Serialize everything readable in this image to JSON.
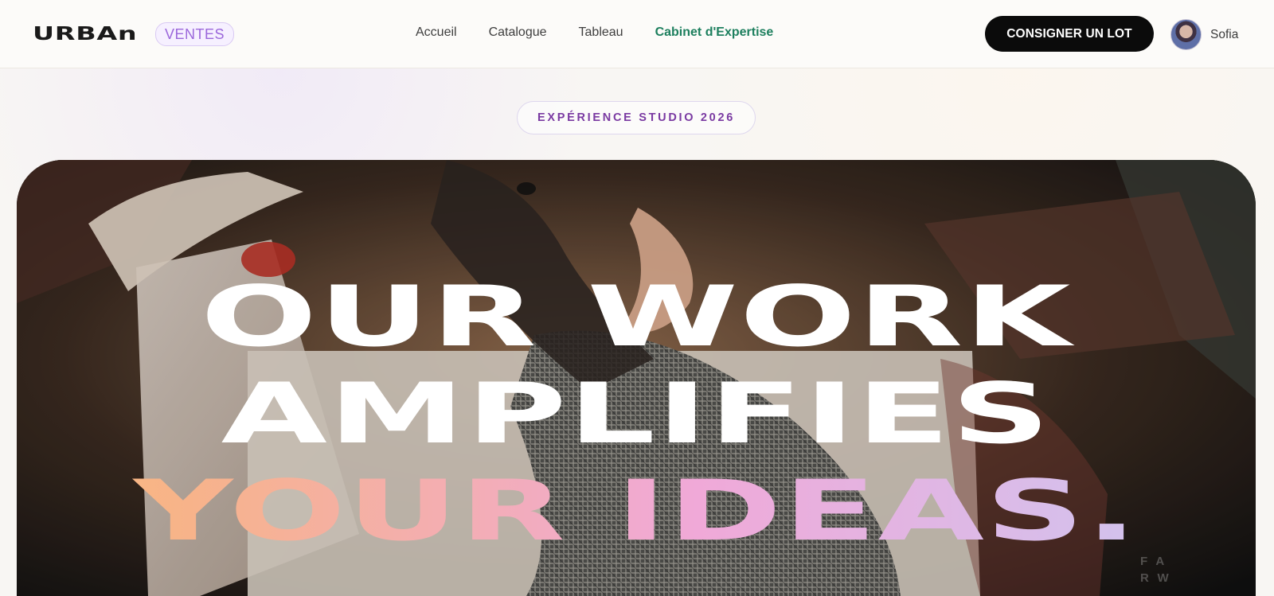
{
  "header": {
    "logo": "URBAn",
    "badge": "VENTES",
    "nav": [
      {
        "label": "Accueil",
        "active": false
      },
      {
        "label": "Catalogue",
        "active": false
      },
      {
        "label": "Tableau",
        "active": false
      },
      {
        "label": "Cabinet d'Expertise",
        "active": true
      }
    ],
    "cta_label": "CONSIGNER UN LOT",
    "user_name": "Sofia"
  },
  "hero": {
    "badge": "EXPÉRIENCE STUDIO 2026",
    "title_line_1": "OUR WORK",
    "title_line_2": "AMPLIFIES",
    "title_line_3": "YOUR IDEAS.",
    "watermark": "FA RW"
  },
  "colors": {
    "accent_active": "#1d7f5e",
    "badge_purple": "#7a3aa2",
    "cta_bg": "#0b0b0b"
  },
  "icons": {
    "avatar": "user-avatar-icon"
  }
}
